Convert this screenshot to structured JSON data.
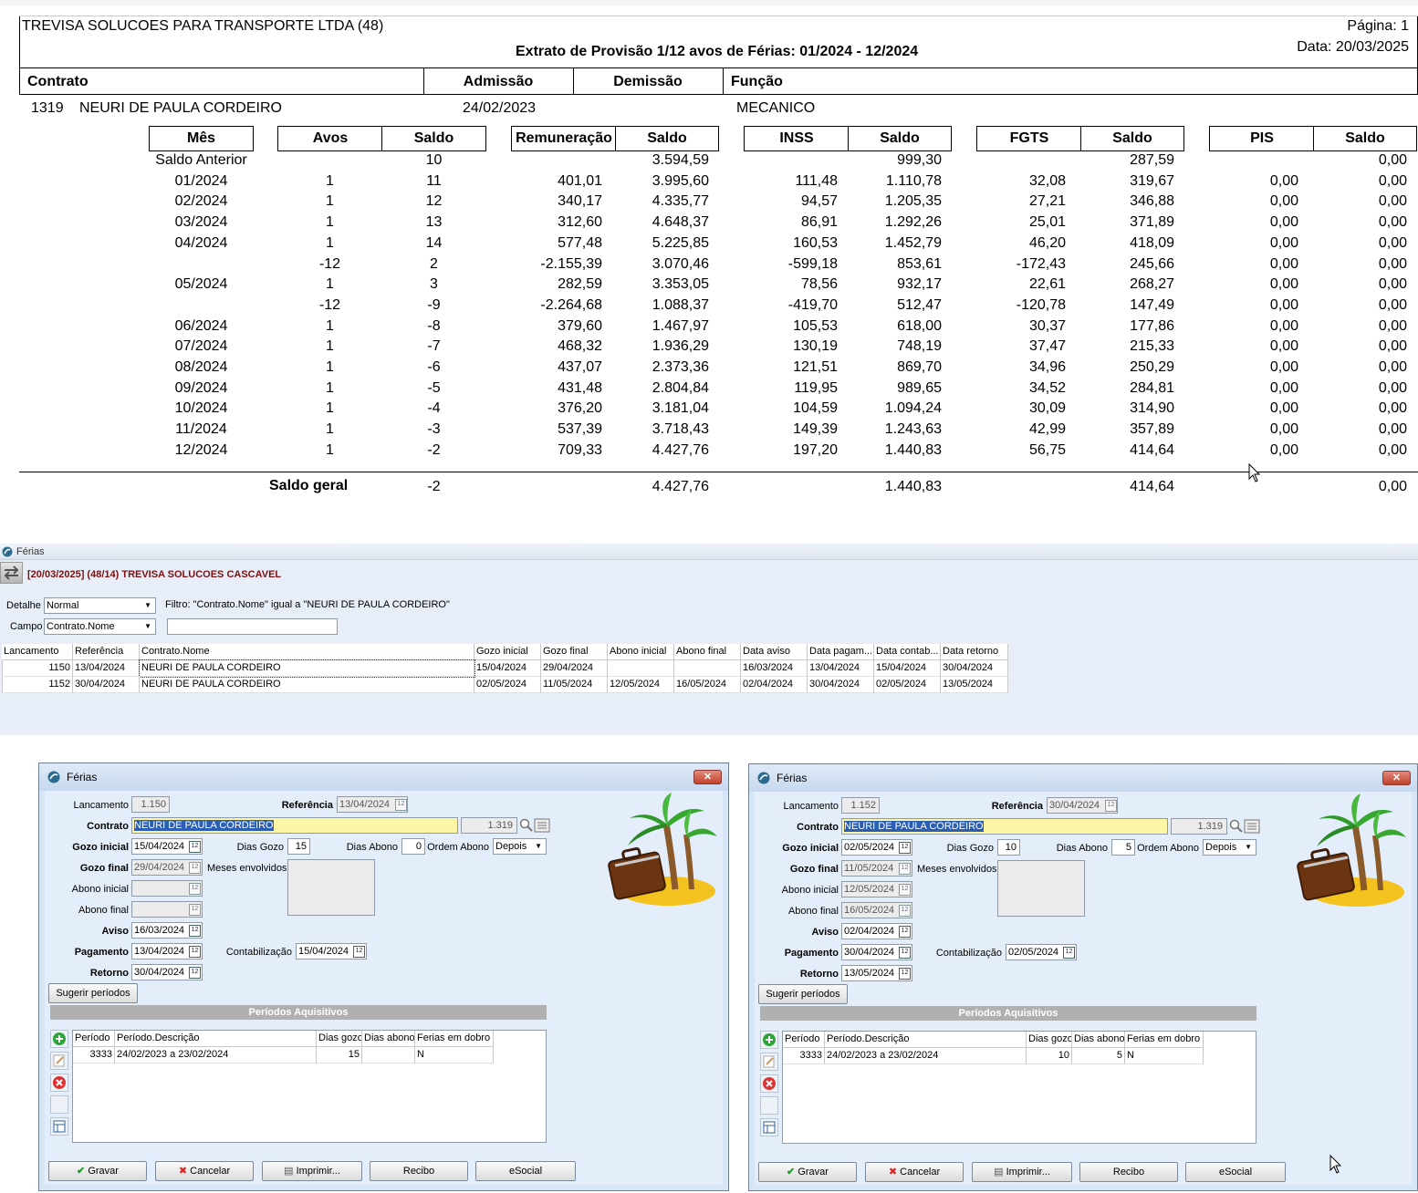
{
  "report": {
    "company": "TREVISA SOLUCOES PARA TRANSPORTE LTDA (48)",
    "title": "Extrato de Provisão 1/12 avos de Férias: 01/2024 - 12/2024",
    "page": "Página: 1",
    "date": "Data: 20/03/2025",
    "header": {
      "contrato": "Contrato",
      "admissao": "Admissão",
      "demissao": "Demissão",
      "funcao": "Função"
    },
    "employee": {
      "id": "1319",
      "name": "NEURI DE PAULA CORDEIRO",
      "admissao": "24/02/2023",
      "funcao": "MECANICO"
    },
    "columns": [
      "Mês",
      "Avos",
      "Saldo",
      "Remuneração",
      "Saldo",
      "INSS",
      "Saldo",
      "FGTS",
      "Saldo",
      "PIS",
      "Saldo"
    ],
    "rows": [
      [
        "Saldo Anterior",
        "",
        "10",
        "",
        "3.594,59",
        "",
        "999,30",
        "",
        "287,59",
        "",
        "0,00"
      ],
      [
        "01/2024",
        "1",
        "11",
        "401,01",
        "3.995,60",
        "111,48",
        "1.110,78",
        "32,08",
        "319,67",
        "0,00",
        "0,00"
      ],
      [
        "02/2024",
        "1",
        "12",
        "340,17",
        "4.335,77",
        "94,57",
        "1.205,35",
        "27,21",
        "346,88",
        "0,00",
        "0,00"
      ],
      [
        "03/2024",
        "1",
        "13",
        "312,60",
        "4.648,37",
        "86,91",
        "1.292,26",
        "25,01",
        "371,89",
        "0,00",
        "0,00"
      ],
      [
        "04/2024",
        "1",
        "14",
        "577,48",
        "5.225,85",
        "160,53",
        "1.452,79",
        "46,20",
        "418,09",
        "0,00",
        "0,00"
      ],
      [
        "",
        "-12",
        "2",
        "-2.155,39",
        "3.070,46",
        "-599,18",
        "853,61",
        "-172,43",
        "245,66",
        "0,00",
        "0,00"
      ],
      [
        "05/2024",
        "1",
        "3",
        "282,59",
        "3.353,05",
        "78,56",
        "932,17",
        "22,61",
        "268,27",
        "0,00",
        "0,00"
      ],
      [
        "",
        "-12",
        "-9",
        "-2.264,68",
        "1.088,37",
        "-419,70",
        "512,47",
        "-120,78",
        "147,49",
        "0,00",
        "0,00"
      ],
      [
        "06/2024",
        "1",
        "-8",
        "379,60",
        "1.467,97",
        "105,53",
        "618,00",
        "30,37",
        "177,86",
        "0,00",
        "0,00"
      ],
      [
        "07/2024",
        "1",
        "-7",
        "468,32",
        "1.936,29",
        "130,19",
        "748,19",
        "37,47",
        "215,33",
        "0,00",
        "0,00"
      ],
      [
        "08/2024",
        "1",
        "-6",
        "437,07",
        "2.373,36",
        "121,51",
        "869,70",
        "34,96",
        "250,29",
        "0,00",
        "0,00"
      ],
      [
        "09/2024",
        "1",
        "-5",
        "431,48",
        "2.804,84",
        "119,95",
        "989,65",
        "34,52",
        "284,81",
        "0,00",
        "0,00"
      ],
      [
        "10/2024",
        "1",
        "-4",
        "376,20",
        "3.181,04",
        "104,59",
        "1.094,24",
        "30,09",
        "314,90",
        "0,00",
        "0,00"
      ],
      [
        "11/2024",
        "1",
        "-3",
        "537,39",
        "3.718,43",
        "149,39",
        "1.243,63",
        "42,99",
        "357,89",
        "0,00",
        "0,00"
      ],
      [
        "12/2024",
        "1",
        "-2",
        "709,33",
        "4.427,76",
        "197,20",
        "1.440,83",
        "56,75",
        "414,64",
        "0,00",
        "0,00"
      ]
    ],
    "total": {
      "label": "Saldo geral",
      "avos": "-2",
      "rem": "4.427,76",
      "inss": "1.440,83",
      "fgts": "414,64",
      "pis": "0,00"
    }
  },
  "app": {
    "window_title": "Férias",
    "context": "[20/03/2025] (48/14) TREVISA SOLUCOES CASCAVEL",
    "detalhe_label": "Detalhe",
    "detalhe_value": "Normal",
    "filter_text": "Filtro: \"Contrato.Nome\" igual a \"NEURI DE PAULA CORDEIRO\"",
    "campo_label": "Campo",
    "campo_value": "Contrato.Nome",
    "grid": {
      "columns": [
        "Lancamento",
        "Referência",
        "Contrato.Nome",
        "Gozo inicial",
        "Gozo final",
        "Abono inicial",
        "Abono final",
        "Data aviso",
        "Data pagam...",
        "Data contab...",
        "Data retorno"
      ],
      "rows": [
        [
          "1150",
          "13/04/2024",
          "NEURI DE PAULA CORDEIRO",
          "15/04/2024",
          "29/04/2024",
          "",
          "",
          "16/03/2024",
          "13/04/2024",
          "15/04/2024",
          "30/04/2024"
        ],
        [
          "1152",
          "30/04/2024",
          "NEURI DE PAULA CORDEIRO",
          "02/05/2024",
          "11/05/2024",
          "12/05/2024",
          "16/05/2024",
          "02/04/2024",
          "30/04/2024",
          "02/05/2024",
          "13/05/2024"
        ]
      ]
    }
  },
  "labels": {
    "lancamento": "Lancamento",
    "referencia": "Referência",
    "contrato": "Contrato",
    "gozo_inicial": "Gozo inicial",
    "dias_gozo": "Dias Gozo",
    "dias_abono": "Dias Abono",
    "ordem_abono": "Ordem Abono",
    "gozo_final": "Gozo final",
    "meses": "Meses envolvidos",
    "abono_inicial": "Abono inicial",
    "abono_final": "Abono final",
    "aviso": "Aviso",
    "pagamento": "Pagamento",
    "contabilizacao": "Contabilização",
    "retorno": "Retorno",
    "sugerir": "Sugerir períodos",
    "periodos": "Períodos Aquisitivos",
    "p_col1": "Período",
    "p_col2": "Período.Descrição",
    "p_col3": "Dias gozo",
    "p_col4": "Dias abono",
    "p_col5": "Ferias em dobro",
    "gravar": "Gravar",
    "cancelar": "Cancelar",
    "imprimir": "Imprimir...",
    "recibo": "Recibo",
    "esocial": "eSocial",
    "cal": "12"
  },
  "dialogs": [
    {
      "title": "Férias",
      "lancamento": "1.150",
      "referencia": "13/04/2024",
      "contrato": "NEURI DE PAULA CORDEIRO",
      "contrato_id": "1.319",
      "gozo_inicial": "15/04/2024",
      "dias_gozo": "15",
      "dias_abono": "0",
      "ordem_abono": "Depois",
      "gozo_final": "29/04/2024",
      "abono_inicial": "",
      "abono_final": "",
      "aviso": "16/03/2024",
      "pagamento": "13/04/2024",
      "contabilizacao": "15/04/2024",
      "retorno": "30/04/2024",
      "periodo": [
        "3333",
        "24/02/2023 a 23/02/2024",
        "15",
        "",
        "N"
      ]
    },
    {
      "title": "Férias",
      "lancamento": "1.152",
      "referencia": "30/04/2024",
      "contrato": "NEURI DE PAULA CORDEIRO",
      "contrato_id": "1.319",
      "gozo_inicial": "02/05/2024",
      "dias_gozo": "10",
      "dias_abono": "5",
      "ordem_abono": "Depois",
      "gozo_final": "11/05/2024",
      "abono_inicial": "12/05/2024",
      "abono_final": "16/05/2024",
      "aviso": "02/04/2024",
      "pagamento": "30/04/2024",
      "contabilizacao": "02/05/2024",
      "retorno": "13/05/2024",
      "periodo": [
        "3333",
        "24/02/2023 a 23/02/2024",
        "10",
        "5",
        "N"
      ]
    }
  ]
}
